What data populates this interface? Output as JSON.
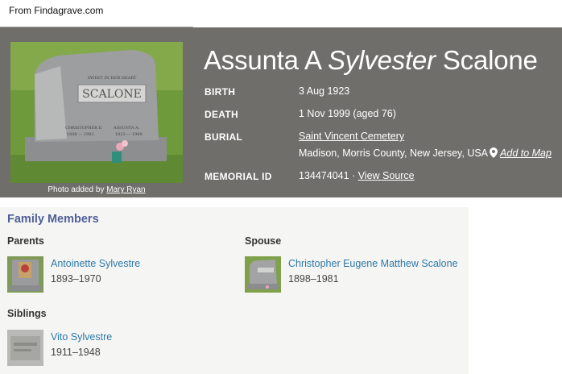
{
  "source_note": "From Findagrave.com",
  "memorial": {
    "name_first": "Assunta A",
    "name_middle": "Sylvester",
    "name_last": "Scalone",
    "photo_credit_prefix": "Photo added by",
    "photo_credit_user": "Mary Ryan",
    "headstone_lettering": {
      "top_phrase": "SWEET IN HER HEART",
      "surname": "SCALONE",
      "left_name": "CHRISTOPHER E.",
      "left_dates": "1898 — 1981",
      "right_name": "ASSUNTA A.",
      "right_dates": "1923 — 1999"
    },
    "birth_label": "BIRTH",
    "birth_value": "3 Aug 1923",
    "death_label": "DEATH",
    "death_value": "1 Nov 1999 (aged 76)",
    "burial_label": "BURIAL",
    "burial_cemetery": "Saint Vincent Cemetery",
    "burial_location": "Madison, Morris County, New Jersey, USA",
    "add_to_map": "Add to Map",
    "memorial_id_label": "MEMORIAL ID",
    "memorial_id_value": "134474041",
    "id_separator": " · ",
    "view_source": "View Source"
  },
  "family": {
    "title": "Family Members",
    "parents_title": "Parents",
    "spouse_title": "Spouse",
    "siblings_title": "Siblings",
    "parents": [
      {
        "name": "Antoinette Sylvestre",
        "dates": "1893–1970"
      }
    ],
    "spouse": [
      {
        "name": "Christopher Eugene Matthew Scalone",
        "dates": "1898–1981"
      }
    ],
    "siblings": [
      {
        "name": "Vito Sylvestre",
        "dates": "1911–1948"
      }
    ]
  },
  "colors": {
    "hero_bg": "#706e6b",
    "link_blue": "#2d79a8",
    "section_title": "#4f5e96",
    "family_bg": "#f5f5f4"
  },
  "icons": [
    "map-pin-icon"
  ]
}
